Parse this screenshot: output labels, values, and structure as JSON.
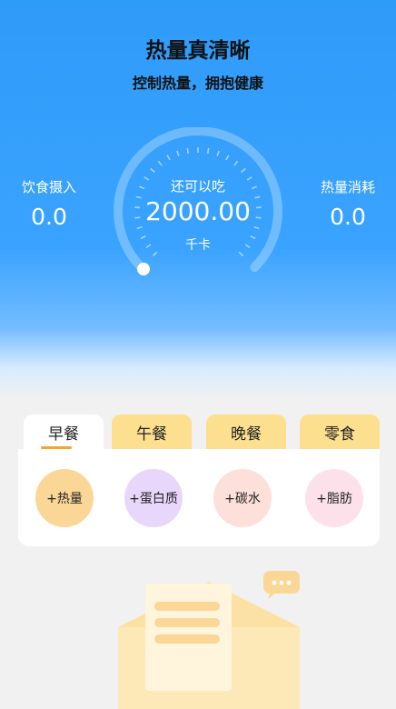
{
  "header": {
    "title": "热量真清晰",
    "subtitle": "控制热量，拥抱健康"
  },
  "summary": {
    "intake_label": "饮食摄入",
    "intake_value": "0.0",
    "burn_label": "热量消耗",
    "burn_value": "0.0",
    "remaining_label": "还可以吃",
    "remaining_value": "2000.00",
    "remaining_unit": "千卡",
    "progress": 0
  },
  "meals": {
    "tabs": [
      "早餐",
      "午餐",
      "晚餐",
      "零食"
    ],
    "active_tab": 0,
    "buttons": [
      "+热量",
      "+蛋白质",
      "+碳水",
      "+脂肪"
    ]
  },
  "colors": {
    "primary": "#3aa3ff",
    "tab_inactive": "#fde08f",
    "accent": "#f5a623",
    "calorie": "#fbd797",
    "protein": "#e9d6fb",
    "carbs": "#fde0d9",
    "fat": "#fde1ea"
  }
}
